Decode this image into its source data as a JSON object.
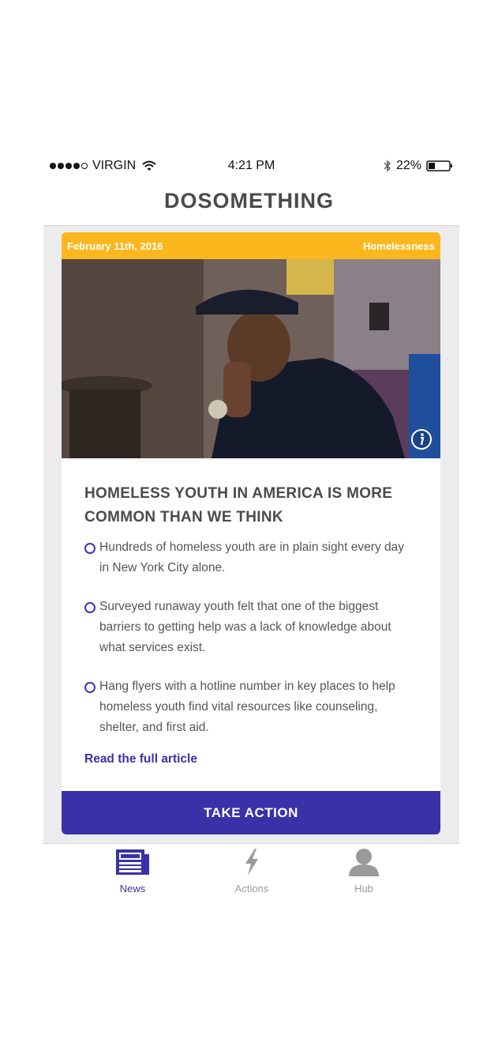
{
  "status_bar": {
    "carrier": "VIRGIN",
    "time": "4:21 PM",
    "battery": "22%"
  },
  "app": {
    "title": "DOSOMETHING"
  },
  "card": {
    "date": "February 11th, 2016",
    "category": "Homelessness",
    "headline_line1": "HOMELESS YOUTH IN AMERICA IS MORE",
    "headline_line2": "COMMON THAN WE THINK",
    "facts": [
      {
        "line1": "Hundreds of homeless youth are in plain sight every day",
        "line2": "in New York City alone.",
        "line3": ""
      },
      {
        "line1": "Surveyed runaway youth felt that one of the biggest",
        "line2": "barriers to getting help was a lack of knowledge about",
        "line3": "what services exist."
      },
      {
        "line1": "Hang flyers with a hotline number in key places to help",
        "line2": "homeless youth find vital resources like counseling,",
        "line3": "shelter, and first aid."
      }
    ],
    "read_more": "Read the full article",
    "cta": "TAKE ACTION"
  },
  "tabs": [
    {
      "label": "News",
      "icon": "newspaper-icon",
      "active": true
    },
    {
      "label": "Actions",
      "icon": "lightning-icon",
      "active": false
    },
    {
      "label": "Hub",
      "icon": "user-icon",
      "active": false
    }
  ],
  "colors": {
    "accent": "#3a31a8",
    "header_yellow": "#fbb71d"
  }
}
